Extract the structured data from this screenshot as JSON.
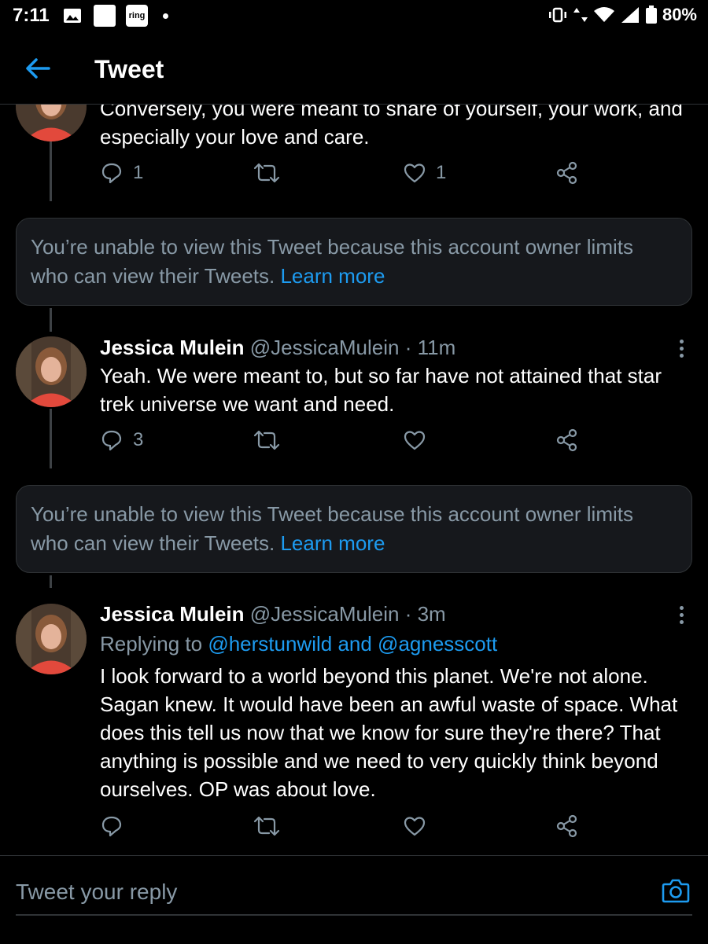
{
  "status_bar": {
    "time": "7:11",
    "ring_label": "ring",
    "battery": "80%"
  },
  "header": {
    "title": "Tweet"
  },
  "tweet0": {
    "text": "Conversely, you were meant to share of yourself, your work, and especially your love and care.",
    "replies": "1",
    "likes": "1"
  },
  "notice1": {
    "text": "You’re unable to view this Tweet because this account owner limits who can view their Tweets. ",
    "link": "Learn more"
  },
  "tweet1": {
    "name": "Jessica Mulein",
    "handle": "@JessicaMulein",
    "time": "· 11m",
    "text": "Yeah. We were meant to, but so far have not attained that star trek universe we want and need.",
    "replies": "3"
  },
  "notice2": {
    "text": "You’re unable to view this Tweet because this account owner limits who can view their Tweets. ",
    "link": "Learn more"
  },
  "tweet2": {
    "name": "Jessica Mulein",
    "handle": "@JessicaMulein",
    "time": "· 3m",
    "replying_prefix": "Replying to ",
    "replying_users": "@herstunwild and @agnesscott",
    "text": "I look forward to a world beyond this planet. We're not alone. Sagan knew. It would have been an awful waste of space. What does this tell us now that we know for sure they're there? That anything is possible and we need to very quickly think beyond ourselves. OP was about love."
  },
  "reply_box": {
    "placeholder": "Tweet your reply"
  },
  "colors": {
    "accent": "#1d9bf0",
    "muted": "#8899a6",
    "background": "#000000",
    "card": "#16181c"
  }
}
